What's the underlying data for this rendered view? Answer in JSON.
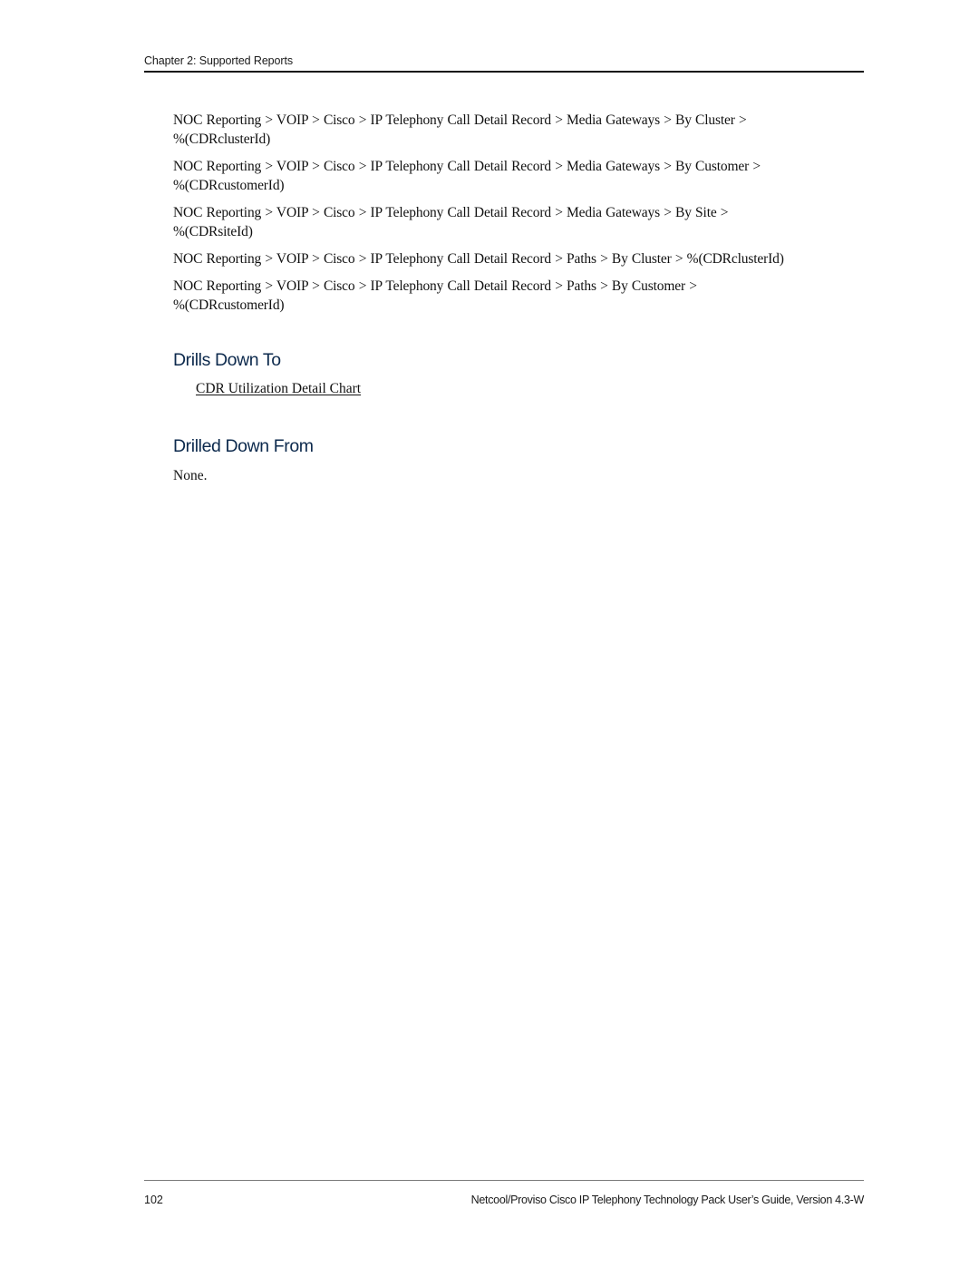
{
  "header": {
    "running_title": "Chapter 2: Supported Reports"
  },
  "paths": [
    {
      "line1": "NOC Reporting >  VOIP >  Cisco >  IP Telephony Call Detail Record >  Media Gateways >  By Cluster >",
      "line2": "%(CDRclusterId)"
    },
    {
      "line1": "NOC Reporting >  VOIP >  Cisco >  IP Telephony Call Detail Record >  Media Gateways >  By Customer >",
      "line2": "%(CDRcustomerId)"
    },
    {
      "line1": "NOC Reporting >  VOIP >  Cisco >  IP Telephony Call Detail Record >  Media Gateways >  By Site >",
      "line2": "%(CDRsiteId)"
    },
    {
      "line1": "NOC Reporting >  VOIP >  Cisco >  IP Telephony Call Detail Record >  Paths >  By Cluster >  %(CDRclusterId)",
      "line2": ""
    },
    {
      "line1": "NOC Reporting >  VOIP >  Cisco >  IP Telephony Call Detail Record >  Paths >  By Customer >",
      "line2": "%(CDRcustomerId)"
    }
  ],
  "drills_down_to": {
    "heading": "Drills Down To",
    "link_text": "CDR Utilization Detail Chart"
  },
  "drilled_down_from": {
    "heading": "Drilled Down From",
    "text": "None."
  },
  "footer": {
    "page_number": "102",
    "document_title": "Netcool/Proviso Cisco IP Telephony Technology Pack User’s Guide, Version 4.3-W"
  },
  "colors": {
    "heading": "#0d2a4d",
    "body_text": "#111111",
    "footer_rule": "#7a7a7a"
  }
}
